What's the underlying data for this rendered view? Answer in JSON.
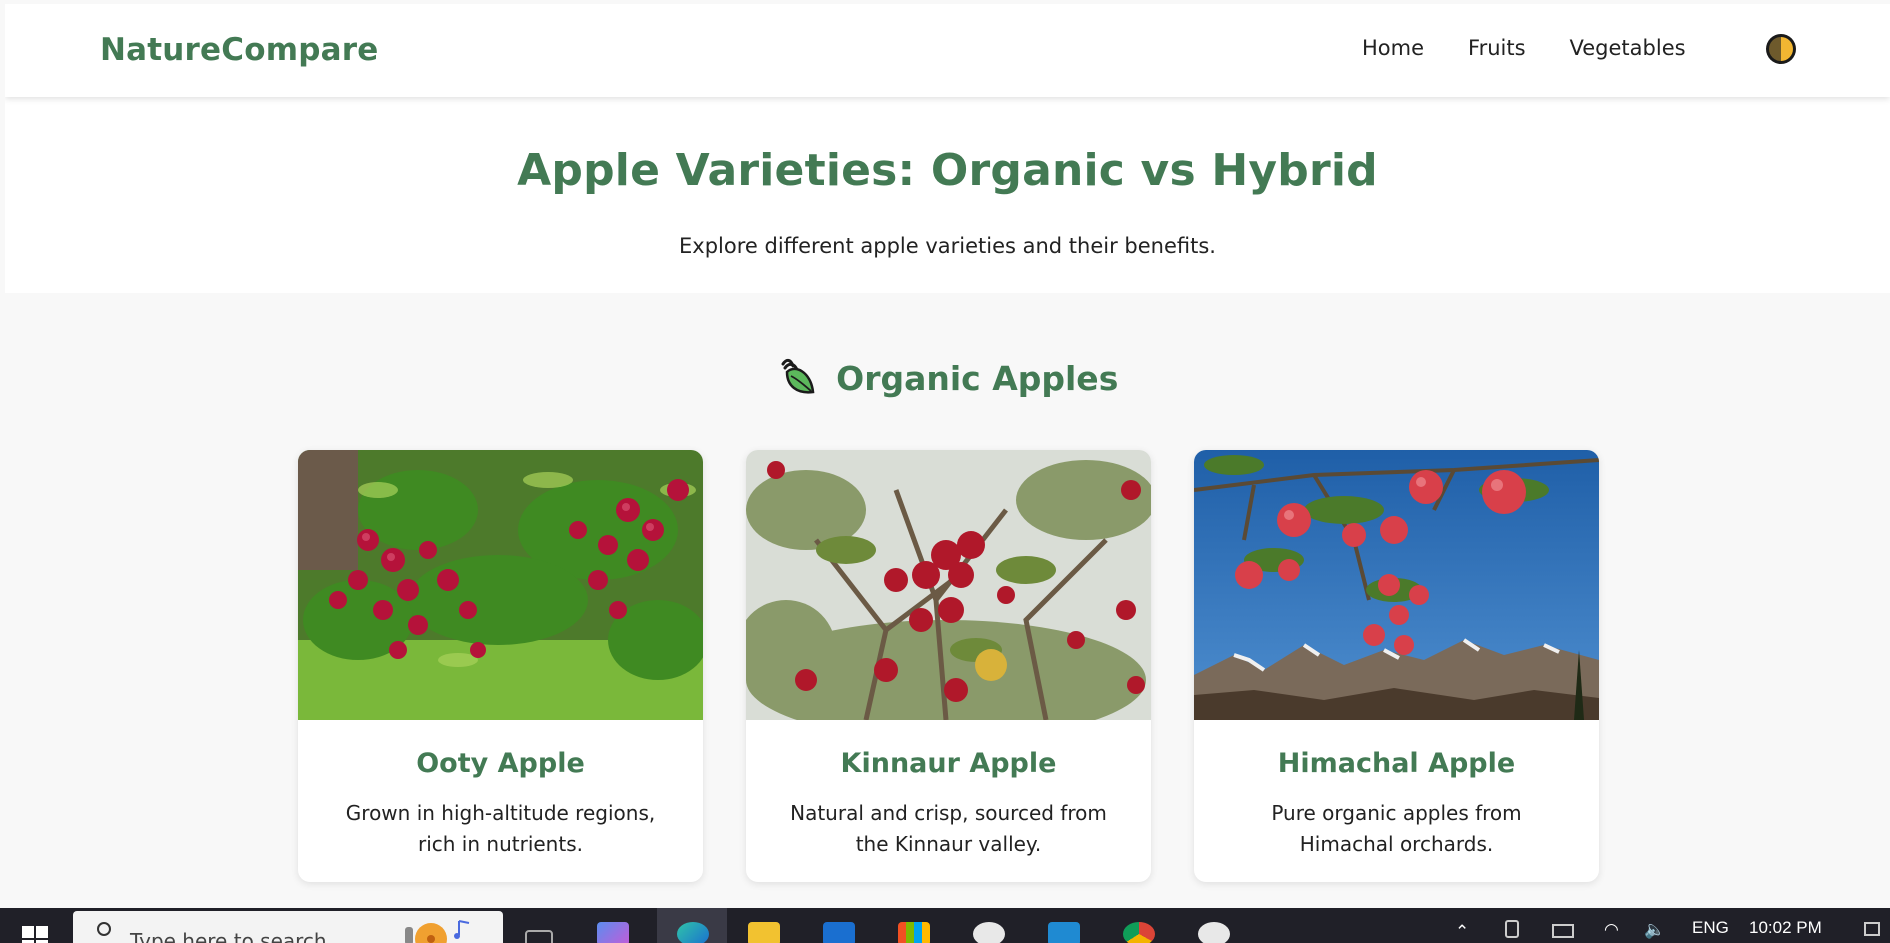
{
  "header": {
    "brand": "NatureCompare",
    "nav": [
      "Home",
      "Fruits",
      "Vegetables"
    ],
    "theme_toggle_icon": "contrast-toggle-icon"
  },
  "hero": {
    "title": "Apple Varieties: Organic vs Hybrid",
    "subtitle": "Explore different apple varieties and their benefits."
  },
  "section": {
    "title": "Organic Apples",
    "icon": "leaf-icon"
  },
  "cards": [
    {
      "title": "Ooty Apple",
      "description": "Grown in high-altitude regions, rich in nutrients."
    },
    {
      "title": "Kinnaur Apple",
      "description": "Natural and crisp, sourced from the Kinnaur valley."
    },
    {
      "title": "Himachal Apple",
      "description": "Pure organic apples from Himachal orchards."
    }
  ],
  "taskbar": {
    "search_placeholder": "Type here to search",
    "language": "ENG",
    "time": "10:02 PM"
  },
  "colors": {
    "brand_green": "#437a54",
    "taskbar": "#202028"
  }
}
